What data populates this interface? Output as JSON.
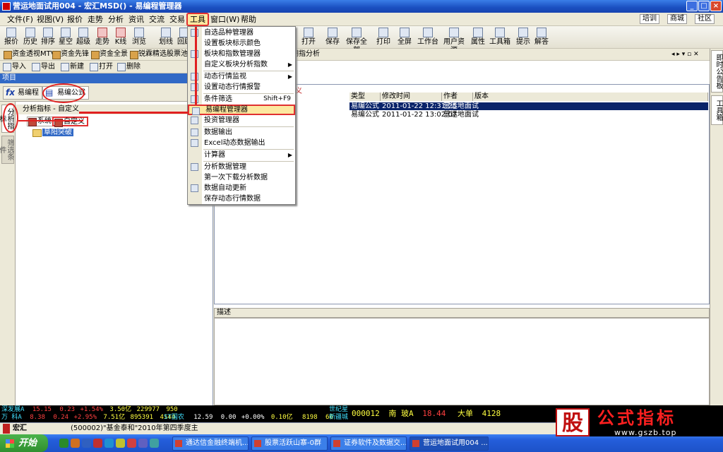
{
  "window": {
    "title": "营运地面试用004 - 宏汇MSD() - 易编程管理器"
  },
  "menubar": {
    "items": [
      "文件(F)",
      "视图(V)",
      "报价",
      "走势",
      "分析",
      "资讯",
      "交流",
      "交易",
      "工具",
      "窗口(W)",
      "帮助"
    ],
    "right_links": [
      "培训",
      "商城",
      "社区"
    ]
  },
  "toolbar": {
    "items": [
      "报价",
      "历史",
      "排序",
      "星空",
      "超级",
      "走势",
      "K线",
      "浏览",
      "划线",
      "回顾",
      "打开",
      "保存",
      "保存全部",
      "打印",
      "全屏",
      "工作台",
      "用户资源",
      "属性",
      "工具箱",
      "提示",
      "解答"
    ]
  },
  "quicktabs": [
    "资金透视MTV",
    "资金先锋",
    "资金全景",
    "锐霖精选股票池",
    "期指分析"
  ],
  "leftbar": {
    "import": "导入",
    "export": "导出",
    "new": "新建",
    "open": "打开",
    "delete": "删除"
  },
  "project": {
    "header": "项目",
    "tab1": "易编程",
    "tab2": "易编公式"
  },
  "vtabs": {
    "analysis": "分析指标",
    "filter": "筛选条件"
  },
  "tree": {
    "header": "分析指标 - 自定义",
    "opt_system": "系统",
    "opt_custom": "自定义",
    "node": "阜阳突破"
  },
  "dropdown": {
    "items": [
      {
        "label": "自选品种管理器"
      },
      {
        "label": "设置板块标示颜色"
      },
      {
        "label": "板块和指数管理器"
      },
      {
        "label": "自定义板块分析指数",
        "submenu": true
      },
      {
        "label": "动态行情监视",
        "submenu": true
      },
      {
        "label": "设置动态行情报警"
      },
      {
        "label": "条件筛选",
        "shortcut": "Shift+F9"
      },
      {
        "label": "易编程管理器",
        "highlighted": true
      },
      {
        "label": "投资管理器"
      },
      {
        "label": "数据输出"
      },
      {
        "label": "Excel动态数据输出"
      },
      {
        "label": "计算器",
        "submenu": true
      },
      {
        "label": "分析数据管理"
      },
      {
        "label": "第一次下载分析数据"
      },
      {
        "label": "数据自动更新"
      },
      {
        "label": "保存动态行情数据"
      }
    ]
  },
  "table": {
    "label_custom": "定义",
    "headers": [
      "类型",
      "修改时间",
      "作者",
      "版本"
    ],
    "rows": [
      {
        "type": "易编公式",
        "time": "2011-01-22 12:31:25",
        "author": "营运地面试",
        "version": "",
        "selected": true
      },
      {
        "type": "易编公式",
        "time": "2011-01-22 13:02:07",
        "author": "营运地面试",
        "version": "",
        "selected": false
      }
    ]
  },
  "description": {
    "label": "描述"
  },
  "rightstrip": {
    "tab1": "即时公告板",
    "tab2": "工具箱"
  },
  "ticker": {
    "row1": {
      "name": "深发展A",
      "price": "15.15",
      "chg": "0.23",
      "pct": "+1.54%",
      "amt": "3.50亿",
      "vol": "229977",
      "n": "950"
    },
    "row2": {
      "name": "万 科A",
      "price": "8.38",
      "chg": "0.24",
      "pct": "+2.95%",
      "amt": "7.51亿",
      "vol": "895391",
      "n": "4144"
    },
    "mid": {
      "name": "ST国农",
      "price": "12.59",
      "chg": "0.00",
      "pct": "+0.00%",
      "amt": "0.10亿",
      "vol": "8198",
      "n": "66"
    },
    "lbl1": "世纪星",
    "lbl2": "新疆城",
    "trade": {
      "code": "000012",
      "name": "南 玻A",
      "price": "18.44",
      "type": "大单",
      "qty": "4128"
    }
  },
  "newsbar": {
    "brand": "宏汇",
    "text": "(500002)\"基金泰和\"2010年第四季度主"
  },
  "taskbar": {
    "start": "开始",
    "tasks": [
      "通达信金融终端机...",
      "股票活跃山寨-0群",
      "证券软件及数据交...",
      "营运地面试用004 ..."
    ]
  },
  "watermark": {
    "logo": "股",
    "title": "公式指标",
    "url": "www.gszb.top"
  },
  "colors": {
    "highlight": "#fce8a0",
    "annotation": "#e02020",
    "selection": "#0a246a"
  }
}
